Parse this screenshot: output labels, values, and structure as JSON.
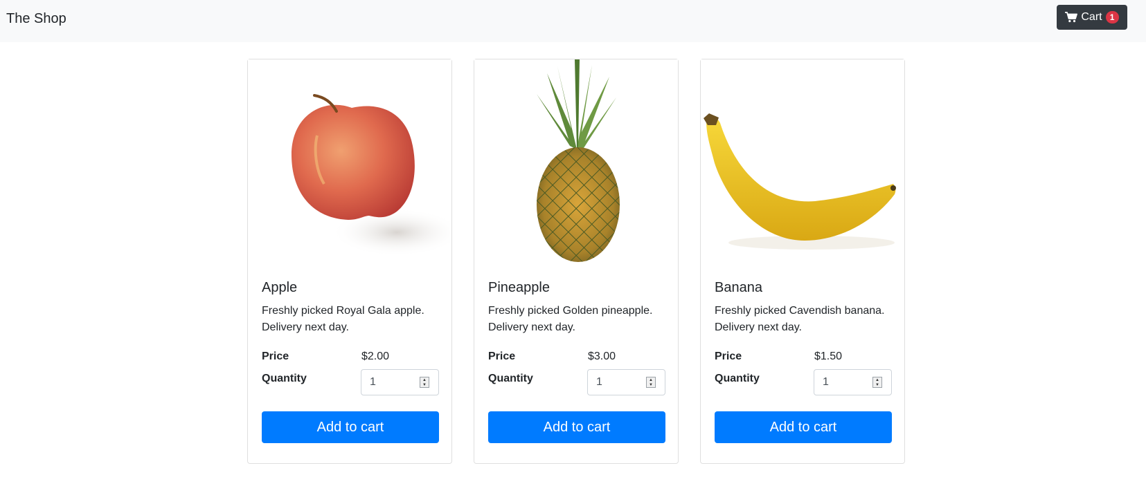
{
  "navbar": {
    "brand": "The Shop",
    "cart_label": "Cart",
    "cart_count": "1"
  },
  "labels": {
    "price": "Price",
    "quantity": "Quantity",
    "add_to_cart": "Add to cart"
  },
  "products": [
    {
      "name": "Apple",
      "description": "Freshly picked Royal Gala apple. Delivery next day.",
      "price": "$2.00",
      "quantity": "1",
      "image_icon": "apple-image"
    },
    {
      "name": "Pineapple",
      "description": "Freshly picked Golden pineapple. Delivery next day.",
      "price": "$3.00",
      "quantity": "1",
      "image_icon": "pineapple-image"
    },
    {
      "name": "Banana",
      "description": "Freshly picked Cavendish banana. Delivery next day.",
      "price": "$1.50",
      "quantity": "1",
      "image_icon": "banana-image"
    }
  ],
  "colors": {
    "primary": "#007bff",
    "dark": "#343a40",
    "badge": "#dc3545",
    "navbar_bg": "#f8f9fa"
  }
}
